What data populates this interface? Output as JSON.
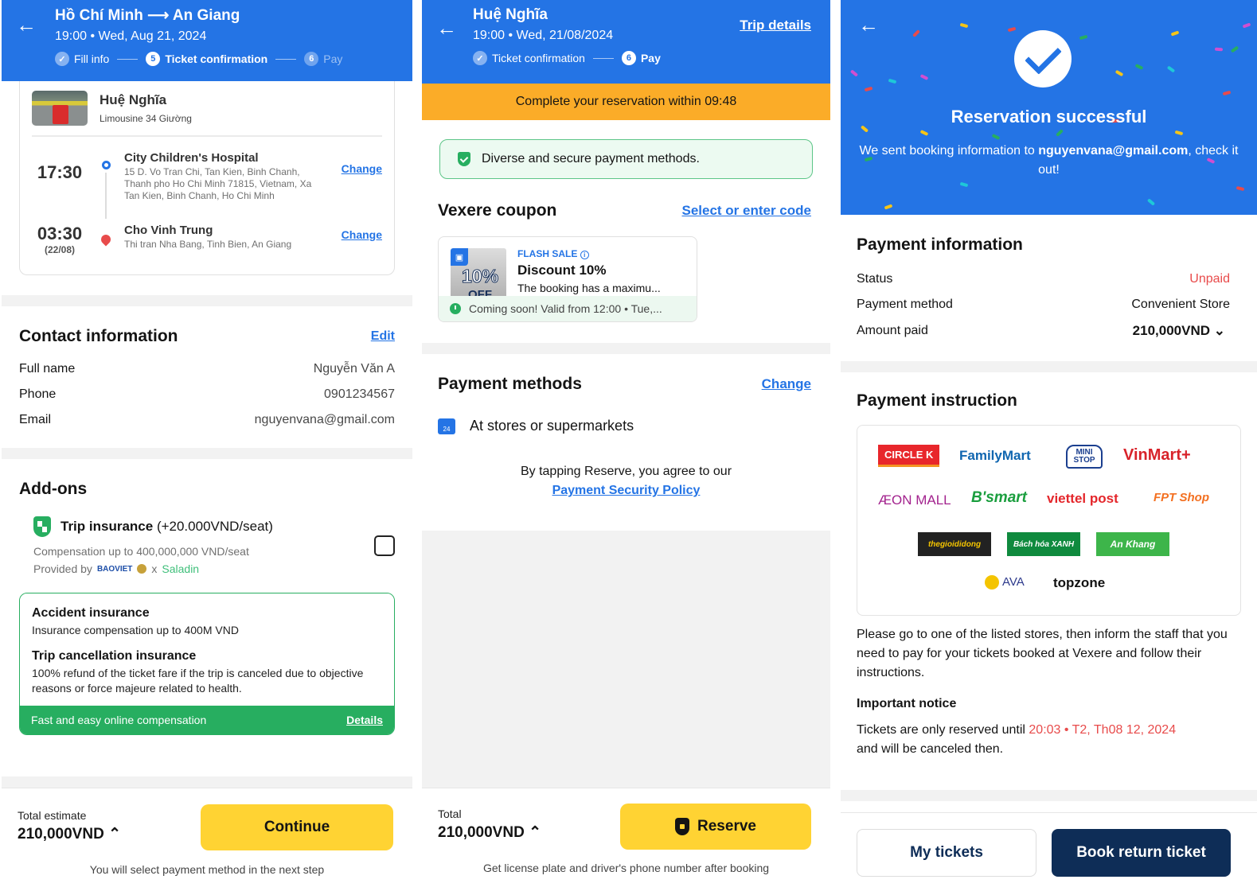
{
  "screen1": {
    "header": {
      "title": "Hồ Chí Minh ⟶ An Giang",
      "subtitle": "19:00 • Wed, Aug 21, 2024",
      "steps": [
        {
          "label": "Fill info",
          "state": "done",
          "num": "✓"
        },
        {
          "label": "Ticket confirmation",
          "state": "current",
          "num": "5"
        },
        {
          "label": "Pay",
          "state": "upcoming",
          "num": "6"
        }
      ]
    },
    "trip": {
      "operator": "Huệ Nghĩa",
      "vehicle": "Limousine 34 Giường",
      "pickup": {
        "time": "17:30",
        "name": "City Children's Hospital",
        "address": "15 D. Vo Tran Chi, Tan Kien, Binh Chanh, Thanh pho Ho Chi Minh 71815, Vietnam, Xa Tan Kien, Binh Chanh, Ho Chi Minh",
        "change_label": "Change"
      },
      "dropoff": {
        "time": "03:30",
        "date": "(22/08)",
        "name": "Cho Vinh Trung",
        "address": "Thi tran Nha Bang, Tinh Bien, An Giang",
        "change_label": "Change"
      }
    },
    "contact": {
      "title": "Contact information",
      "edit_label": "Edit",
      "rows": [
        {
          "label": "Full name",
          "value": "Nguyễn Văn A"
        },
        {
          "label": "Phone",
          "value": "0901234567"
        },
        {
          "label": "Email",
          "value": "nguyenvana@gmail.com"
        }
      ]
    },
    "addons": {
      "title": "Add-ons",
      "insurance_title": "Trip insurance",
      "insurance_price": "(+20.000VND/seat)",
      "compensation": "Compensation up to 400,000,000 VND/seat",
      "provided_by": "Provided by",
      "provider1": "BAOVIET",
      "provider_x": "x",
      "provider2": "Saladin",
      "checked": false,
      "box": {
        "accident_title": "Accident insurance",
        "accident_text": "Insurance compensation up to 400M VND",
        "cancel_title": "Trip cancellation insurance",
        "cancel_text": "100% refund of the ticket fare if the trip is canceled due to objective reasons or force majeure related to health.",
        "footer_text": "Fast and easy online compensation",
        "details_label": "Details"
      }
    },
    "footer": {
      "total_label": "Total estimate",
      "total_value": "210,000VND",
      "button": "Continue",
      "note": "You will select payment method in the next step"
    }
  },
  "screen2": {
    "header": {
      "title": "Huệ Nghĩa",
      "subtitle": "19:00 • Wed, 21/08/2024",
      "trip_details": "Trip details",
      "steps": [
        {
          "label": "Ticket confirmation",
          "state": "done",
          "num": "✓"
        },
        {
          "label": "Pay",
          "state": "current",
          "num": "6"
        }
      ]
    },
    "timer_text": "Complete your reservation within",
    "timer_value": "09:48",
    "secure_text": "Diverse and secure payment methods.",
    "coupon": {
      "title": "Vexere coupon",
      "select_label": "Select or enter code",
      "tag": "FLASH SALE",
      "name": "Discount 10%",
      "desc": "The booking has a maximu...",
      "img_pct": "10%",
      "img_off": "OFF",
      "validity": "Coming soon! Valid from 12:00 • Tue,..."
    },
    "payment": {
      "title": "Payment methods",
      "change_label": "Change",
      "method": "At stores or supermarkets",
      "agree_text": "By tapping Reserve, you agree to our",
      "policy_link": "Payment Security Policy"
    },
    "footer": {
      "total_label": "Total",
      "total_value": "210,000VND",
      "button": "Reserve",
      "note": "Get license plate and driver's phone number after booking"
    }
  },
  "screen3": {
    "hero": {
      "title": "Reservation successful",
      "text_before": "We sent booking information to",
      "email": "nguyenvana@gmail.com",
      "text_after": ", check it out!"
    },
    "payment_info": {
      "title": "Payment information",
      "status_label": "Status",
      "status_value": "Unpaid",
      "method_label": "Payment method",
      "method_value": "Convenient Store",
      "amount_label": "Amount paid",
      "amount_value": "210,000VND"
    },
    "instruction": {
      "title": "Payment instruction",
      "stores": [
        "CIRCLE K",
        "FamilyMart",
        "MINI STOP",
        "VinMart+",
        "ÆON MALL",
        "B'smart",
        "viettel post",
        "FPT Shop",
        "thegioididong",
        "Bách hóa XANH",
        "An Khang",
        "AVA",
        "topzone"
      ],
      "text": "Please go to one of the listed stores, then inform the staff that you need to pay for your tickets booked at Vexere and follow their instructions.",
      "notice_title": "Important notice",
      "notice_before": "Tickets are only reserved until",
      "notice_deadline": "20:03 • T2, Th08 12, 2024",
      "notice_after": "and will be canceled then."
    },
    "footer": {
      "my_tickets": "My tickets",
      "book_return": "Book return ticket"
    }
  },
  "colors": {
    "primary": "#2474e5",
    "yellow": "#ffd333",
    "timer": "#fbac28",
    "green": "#27ae60",
    "red": "#e84b4b",
    "navy": "#0e2d57"
  }
}
